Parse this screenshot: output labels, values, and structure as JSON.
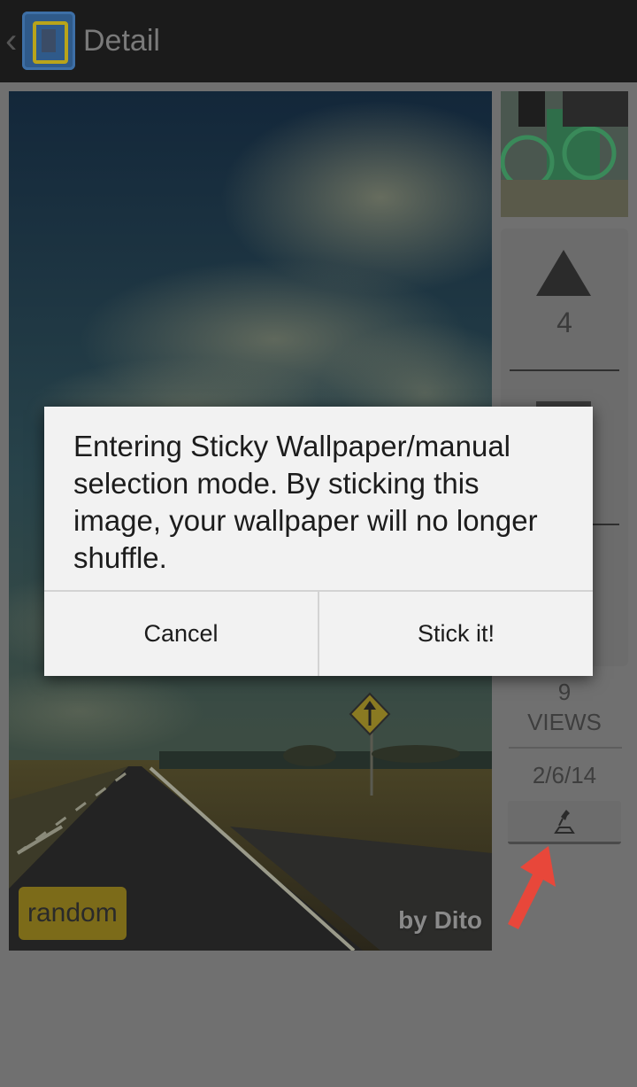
{
  "actionbar": {
    "title": "Detail",
    "back_icon": "chevron-left-icon",
    "app_icon": "app-logo-icon"
  },
  "photo": {
    "badge": "random",
    "credit": "by Dito"
  },
  "sidebar": {
    "vote_count": "4",
    "views_count": "9",
    "views_label": "VIEWS",
    "date": "2/6/14"
  },
  "dialog": {
    "message": "Entering Sticky Wallpaper/manual selection mode. By sticking this image, your wallpaper will no longer shuffle.",
    "cancel_label": "Cancel",
    "confirm_label": "Stick it!"
  },
  "colors": {
    "annotation_arrow": "#e8473a",
    "badge": "#7c6b19",
    "dialog_bg": "#f2f2f2"
  }
}
